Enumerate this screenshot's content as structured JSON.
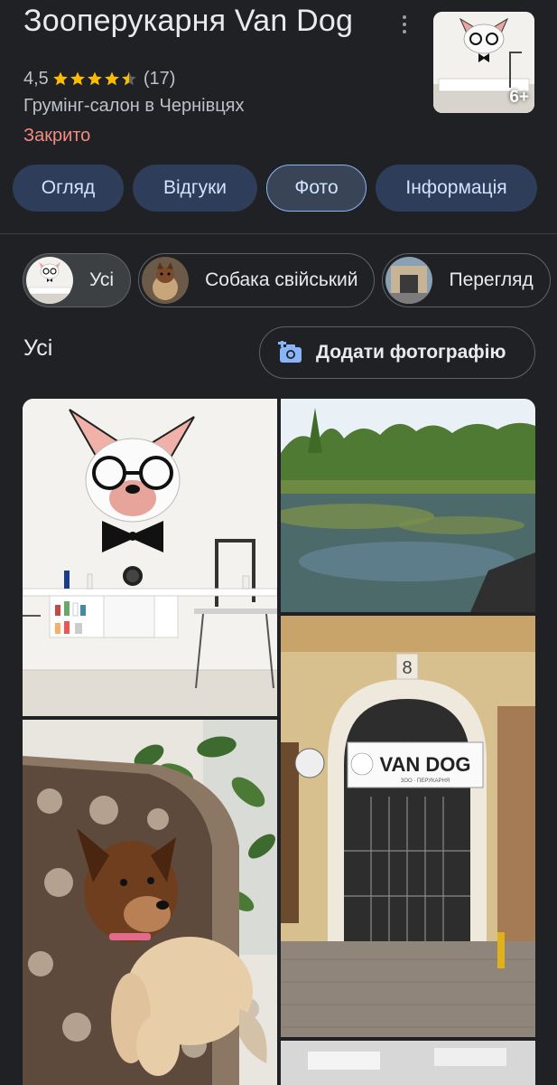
{
  "place": {
    "name": "Зооперукарня Van Dog",
    "rating": "4,5",
    "rating_value": 4.5,
    "review_count": "(17)",
    "category": "Грумінг-салон в Чернівцях",
    "status": "Закрито",
    "status_color": "#f28b82",
    "thumbnail_more": "6+"
  },
  "tabs": [
    {
      "label": "Огляд",
      "active": false
    },
    {
      "label": "Відгуки",
      "active": false
    },
    {
      "label": "Фото",
      "active": true
    },
    {
      "label": "Інформація",
      "active": false
    }
  ],
  "filter_chips": [
    {
      "label": "Усі",
      "active": true
    },
    {
      "label": "Собака свійський",
      "active": false
    },
    {
      "label": "Перегляд",
      "active": false
    }
  ],
  "photos_section": {
    "title": "Усі",
    "add_photo_label": "Додати фотографію"
  },
  "storefront_sign": {
    "brand": "VAN DOG",
    "subtitle": "ЗОО · ПЕРУКАРНЯ",
    "house_number": "8"
  },
  "icons": {
    "more": "more-vert-icon",
    "star": "star-icon",
    "add_photo": "add-a-photo-icon"
  },
  "colors": {
    "background": "#202124",
    "tab_bg": "#2d3d5a",
    "accent": "#8ab4f8",
    "star": "#fbbc04"
  }
}
